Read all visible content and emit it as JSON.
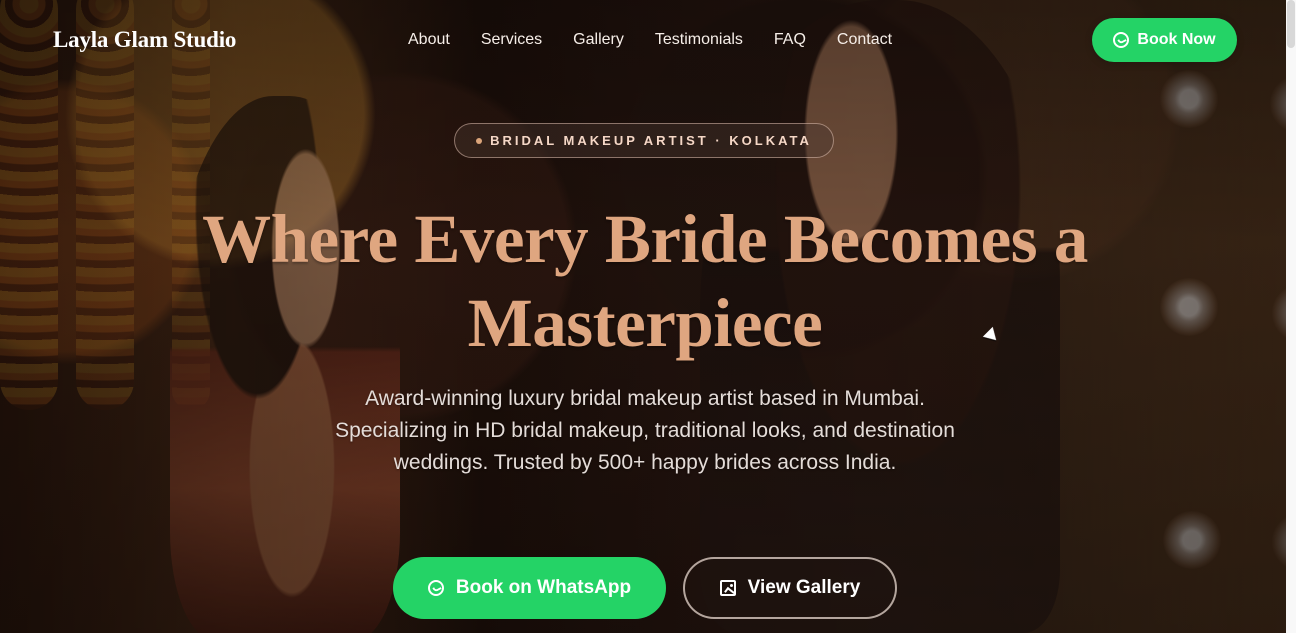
{
  "brand": "Layla Glam Studio",
  "nav": {
    "items": [
      {
        "label": "About"
      },
      {
        "label": "Services"
      },
      {
        "label": "Gallery"
      },
      {
        "label": "Testimonials"
      },
      {
        "label": "FAQ"
      },
      {
        "label": "Contact"
      }
    ],
    "book_now": "Book Now"
  },
  "hero": {
    "badge": "BRIDAL MAKEUP ARTIST · KOLKATA",
    "title_line_1": "Where Every Bride Becomes a",
    "title_line_2": "Masterpiece",
    "description": "Award-winning luxury bridal makeup artist based in Mumbai. Specializing in HD bridal makeup, traditional looks, and destination weddings. Trusted by 500+ happy brides across India.",
    "primary_cta": "Book on WhatsApp",
    "secondary_cta": "View Gallery"
  },
  "icons": {
    "whatsapp": "whatsapp-icon",
    "gallery": "gallery-icon",
    "cursor": "mouse-pointer-icon"
  },
  "colors": {
    "brand_green": "#24d366",
    "title_rose_gold": "#dfa680",
    "dark_overlay": "#1b120d"
  }
}
